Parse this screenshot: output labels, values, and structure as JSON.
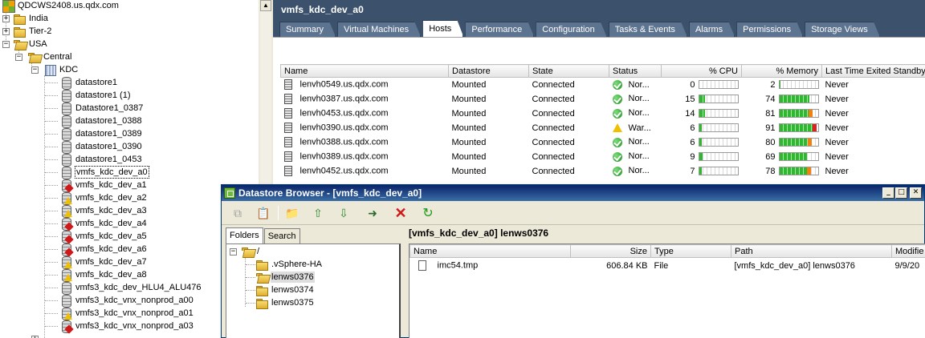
{
  "tree": {
    "root": "QDCWS2408.us.qdx.com",
    "nodes": [
      "India",
      "Tier-2",
      "USA",
      "Central",
      "KDC"
    ],
    "datastores": [
      {
        "label": "datastore1",
        "state": "normal"
      },
      {
        "label": "datastore1 (1)",
        "state": "normal"
      },
      {
        "label": "Datastore1_0387",
        "state": "normal"
      },
      {
        "label": "datastore1_0388",
        "state": "normal"
      },
      {
        "label": "datastore1_0389",
        "state": "normal"
      },
      {
        "label": "datastore1_0390",
        "state": "normal"
      },
      {
        "label": "datastore1_0453",
        "state": "normal"
      },
      {
        "label": "vmfs_kdc_dev_a0",
        "state": "selected"
      },
      {
        "label": "vmfs_kdc_dev_a1",
        "state": "error"
      },
      {
        "label": "vmfs_kdc_dev_a2",
        "state": "warning"
      },
      {
        "label": "vmfs_kdc_dev_a3",
        "state": "warning"
      },
      {
        "label": "vmfs_kdc_dev_a4",
        "state": "error"
      },
      {
        "label": "vmfs_kdc_dev_a5",
        "state": "error"
      },
      {
        "label": "vmfs_kdc_dev_a6",
        "state": "error"
      },
      {
        "label": "vmfs_kdc_dev_a7",
        "state": "warning"
      },
      {
        "label": "vmfs_kdc_dev_a8",
        "state": "warning"
      },
      {
        "label": "vmfs3_kdc_dev_HLU4_ALU476",
        "state": "normal"
      },
      {
        "label": "vmfs3_kdc_vnx_nonprod_a00",
        "state": "normal"
      },
      {
        "label": "vmfs3_kdc_vnx_nonprod_a01",
        "state": "warning"
      },
      {
        "label": "vmfs3_kdc_vnx_nonprod_a03",
        "state": "error"
      }
    ]
  },
  "panel": {
    "title": "vmfs_kdc_dev_a0",
    "tabs": [
      "Summary",
      "Virtual Machines",
      "Hosts",
      "Performance",
      "Configuration",
      "Tasks & Events",
      "Alarms",
      "Permissions",
      "Storage Views"
    ],
    "active_tab": "Hosts"
  },
  "hosts": {
    "columns": [
      "Name",
      "Datastore",
      "State",
      "Status",
      "% CPU",
      "% Memory",
      "Last Time Exited Standby"
    ],
    "rows": [
      {
        "name": "lenvh0549.us.qdx.com",
        "datastore": "Mounted",
        "state": "Connected",
        "status": "Nor...",
        "status_kind": "ok",
        "cpu": 0,
        "mem": 2,
        "standby": "Never"
      },
      {
        "name": "lenvh0387.us.qdx.com",
        "datastore": "Mounted",
        "state": "Connected",
        "status": "Nor...",
        "status_kind": "ok",
        "cpu": 15,
        "mem": 74,
        "standby": "Never"
      },
      {
        "name": "lenvh0453.us.qdx.com",
        "datastore": "Mounted",
        "state": "Connected",
        "status": "Nor...",
        "status_kind": "ok",
        "cpu": 14,
        "mem": 81,
        "standby": "Never"
      },
      {
        "name": "lenvh0390.us.qdx.com",
        "datastore": "Mounted",
        "state": "Connected",
        "status": "War...",
        "status_kind": "warning",
        "cpu": 6,
        "mem": 91,
        "standby": "Never"
      },
      {
        "name": "lenvh0388.us.qdx.com",
        "datastore": "Mounted",
        "state": "Connected",
        "status": "Nor...",
        "status_kind": "ok",
        "cpu": 6,
        "mem": 80,
        "standby": "Never"
      },
      {
        "name": "lenvh0389.us.qdx.com",
        "datastore": "Mounted",
        "state": "Connected",
        "status": "Nor...",
        "status_kind": "ok",
        "cpu": 9,
        "mem": 69,
        "standby": "Never"
      },
      {
        "name": "lenvh0452.us.qdx.com",
        "datastore": "Mounted",
        "state": "Connected",
        "status": "Nor...",
        "status_kind": "ok",
        "cpu": 7,
        "mem": 78,
        "standby": "Never"
      }
    ]
  },
  "browser": {
    "title": "Datastore Browser - [vmfs_kdc_dev_a0]",
    "path": "[vmfs_kdc_dev_a0] lenws0376",
    "folder_tabs": [
      "Folders",
      "Search"
    ],
    "active_folder_tab": "Folders",
    "folders": {
      "root": "/",
      "children": [
        ".vSphere-HA",
        "lenws0376",
        "lenws0374",
        "lenws0375"
      ],
      "selected": "lenws0376"
    },
    "file_columns": [
      "Name",
      "Size",
      "Type",
      "Path",
      "Modifie"
    ],
    "files": [
      {
        "name": "imc54.tmp",
        "size": "606.84 KB",
        "type": "File",
        "path": "[vmfs_kdc_dev_a0] lenws0376",
        "modified": "9/9/20"
      }
    ]
  },
  "colors": {
    "header_bg": "#3c526c",
    "title_bar": "#0a246a",
    "ok_green": "#1d8a1d",
    "warn_yellow": "#f0c000",
    "error_red": "#d01818"
  }
}
